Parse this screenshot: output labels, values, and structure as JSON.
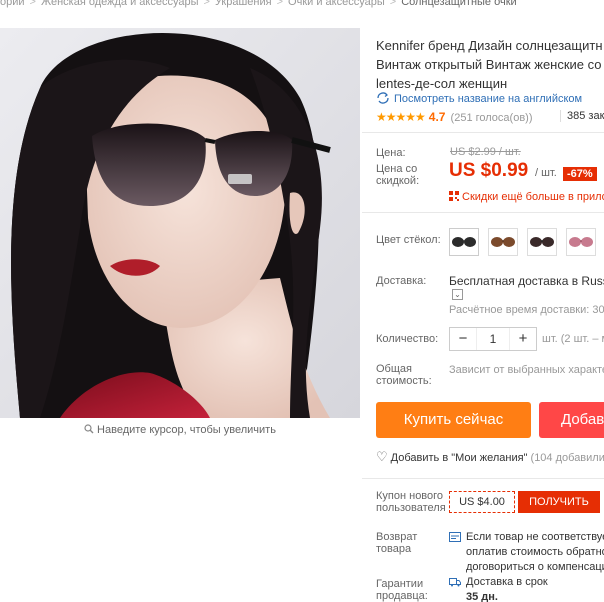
{
  "breadcrumb": [
    "ории",
    "Женская одежда и аксессуары",
    "Украшения",
    "Очки и аксессуары",
    "Солнцезащитные очки"
  ],
  "product": {
    "title_lines": [
      "Kennifer бренд Дизайн солнцезащитн",
      "Винтаж открытый Винтаж женские со",
      "lentes-де-сол женщин"
    ],
    "translate_link": "Посмотреть название на английском",
    "stars": "★★★★★",
    "rating": "4.7",
    "votes": "(251 голоса(ов))",
    "orders": "385 зака"
  },
  "image": {
    "zoom_hint": "Наведите курсор, чтобы увеличить"
  },
  "price": {
    "label": "Цена:",
    "old_value": "US $2.99 / шт.",
    "discount_label": "Цена со скидкой:",
    "new_value": "US $0.99",
    "unit": "/ шт.",
    "discount": "-67%",
    "app_promo": "Скидки ещё больше в прилож"
  },
  "options": {
    "color_label": "Цвет стёкол:",
    "swatches": [
      "black-gradient",
      "brown",
      "black-brown",
      "pink"
    ]
  },
  "shipping": {
    "label": "Доставка:",
    "value": "Бесплатная доставка в Russian",
    "dropdown": "⌄",
    "time": "Расчётное время доставки: 30-"
  },
  "quantity": {
    "label": "Количество:",
    "minus": "−",
    "value": "1",
    "plus": "+",
    "available": "шт. (2 шт. – м"
  },
  "total": {
    "label_line1": "Общая",
    "label_line2": "стоимость:",
    "value": "Зависит от выбранных характе"
  },
  "actions": {
    "buy_now": "Купить сейчас",
    "add_to_cart": "Добав",
    "wishlist": "Добавить в \"Мои желания\"",
    "wishlist_count": "(104 добавили"
  },
  "coupon": {
    "label_line1": "Купон нового",
    "label_line2": "пользователя",
    "value": "US $4.00",
    "button": "ПОЛУЧИТЬ"
  },
  "returns": {
    "label_line1": "Возврат",
    "label_line2": "товара",
    "text_lines": [
      "Если товар не соответствует",
      "оплатив стоимость обратно",
      "договориться о компенсаци"
    ]
  },
  "guarantees": {
    "label_line1": "Гарантии",
    "label_line2": "продавца:",
    "line1": "Доставка в срок",
    "line2": "35 дн."
  },
  "colors": {
    "accent_orange": "#ff7e14",
    "accent_red": "#e62e04",
    "cart_red": "#ff4747",
    "link_blue": "#2f6fb6",
    "star": "#ff9900"
  }
}
